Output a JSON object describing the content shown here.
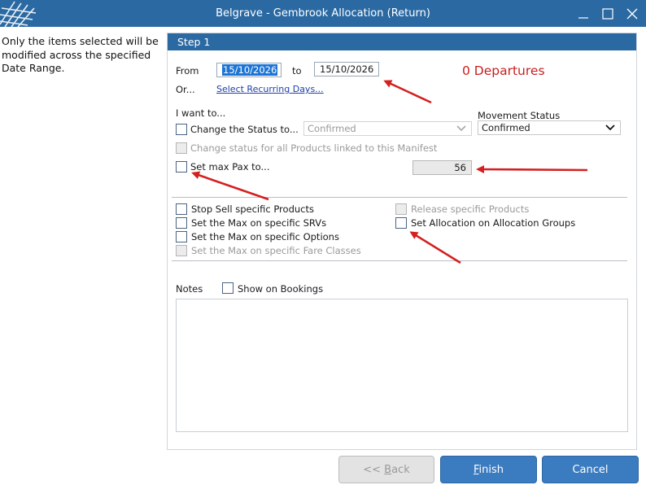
{
  "window": {
    "title": "Belgrave - Gembrook Allocation (Return)"
  },
  "instructions": "Only the items selected will be modified across the specified Date Range.",
  "step": {
    "title": "Step 1"
  },
  "date_range": {
    "from_label": "From",
    "from_value": "15/10/2026",
    "to_label": "to",
    "to_value": "15/10/2026",
    "or_label": "Or...",
    "recurring_link": "Select Recurring Days..."
  },
  "departures": "0 Departures",
  "i_want_to": "I want to...",
  "change_status": {
    "label": "Change the Status to...",
    "value": "Confirmed"
  },
  "movement_status": {
    "label": "Movement Status",
    "value": "Confirmed"
  },
  "change_linked_label": "Change status for all Products linked to this Manifest",
  "max_pax": {
    "label": "Set max Pax to...",
    "value": "56"
  },
  "options": {
    "stop_sell": "Stop Sell specific Products",
    "max_srvs": "Set the Max on specific SRVs",
    "max_options": "Set the Max on specific Options",
    "max_fare_classes": "Set the Max on specific Fare Classes",
    "release_products": "Release specific Products",
    "allocation_groups": "Set Allocation on Allocation Groups"
  },
  "notes": {
    "label": "Notes",
    "show_on_bookings": "Show on Bookings"
  },
  "buttons": {
    "back_prefix": "<< ",
    "back_key": "B",
    "back_rest": "ack",
    "finish_key": "F",
    "finish_rest": "inish",
    "cancel": "Cancel"
  },
  "colors": {
    "title_bar": "#2b69a3",
    "primary_button": "#3b7bbf",
    "departures_text": "#c81e1e",
    "annotation_arrow": "#d42020"
  }
}
